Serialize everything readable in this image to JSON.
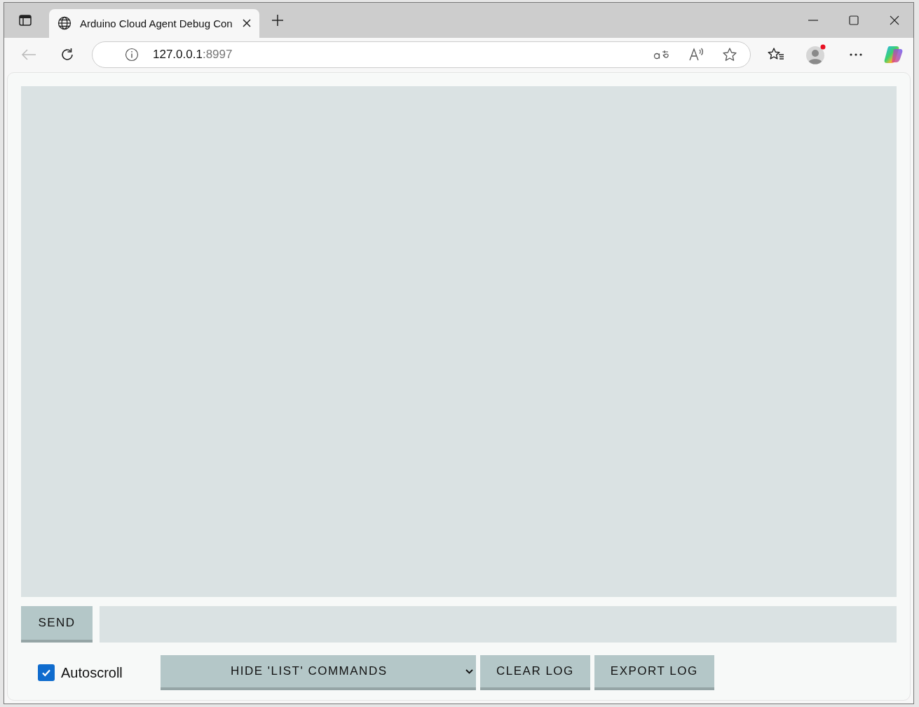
{
  "browser": {
    "tab": {
      "title": "Arduino Cloud Agent Debug Con",
      "selected": true
    },
    "address": {
      "host": "127.0.0.1",
      "port": ":8997"
    }
  },
  "console": {
    "send_button": "SEND",
    "autoscroll": {
      "label": "Autoscroll",
      "checked": true
    },
    "filter_select": {
      "value": "HIDE 'LIST' COMMANDS"
    },
    "buttons": [
      {
        "label": "CLEAR LOG"
      },
      {
        "label": "EXPORT LOG"
      }
    ]
  }
}
